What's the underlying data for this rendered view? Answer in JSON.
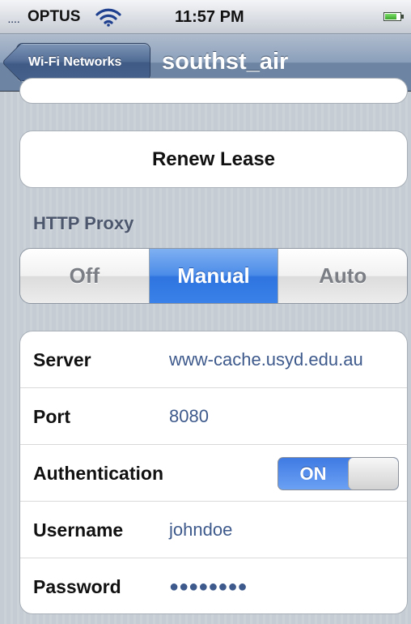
{
  "status_bar": {
    "signal": "....",
    "carrier": "OPTUS",
    "time": "11:57 PM",
    "battery_level": 0.8,
    "wifi_icon": "wifi-icon",
    "battery_icon": "battery-icon"
  },
  "navbar": {
    "back_label": "Wi-Fi Networks",
    "title": "southst_air"
  },
  "renew": {
    "label": "Renew Lease"
  },
  "http_proxy": {
    "header": "HTTP Proxy",
    "options": [
      "Off",
      "Manual",
      "Auto"
    ],
    "selected": "Manual"
  },
  "proxy_fields": {
    "server": {
      "label": "Server",
      "value": "www-cache.usyd.edu.au"
    },
    "port": {
      "label": "Port",
      "value": "8080"
    },
    "authentication": {
      "label": "Authentication",
      "toggle_label": "ON",
      "enabled": true
    },
    "username": {
      "label": "Username",
      "value": "johndoe"
    },
    "password": {
      "label": "Password",
      "value": "●●●●●●●●"
    }
  },
  "colors": {
    "selected_segment": "#3a82ea",
    "value_text": "#3e5a8c",
    "navbar": "#6d84a2",
    "background": "#c5ccd4"
  }
}
